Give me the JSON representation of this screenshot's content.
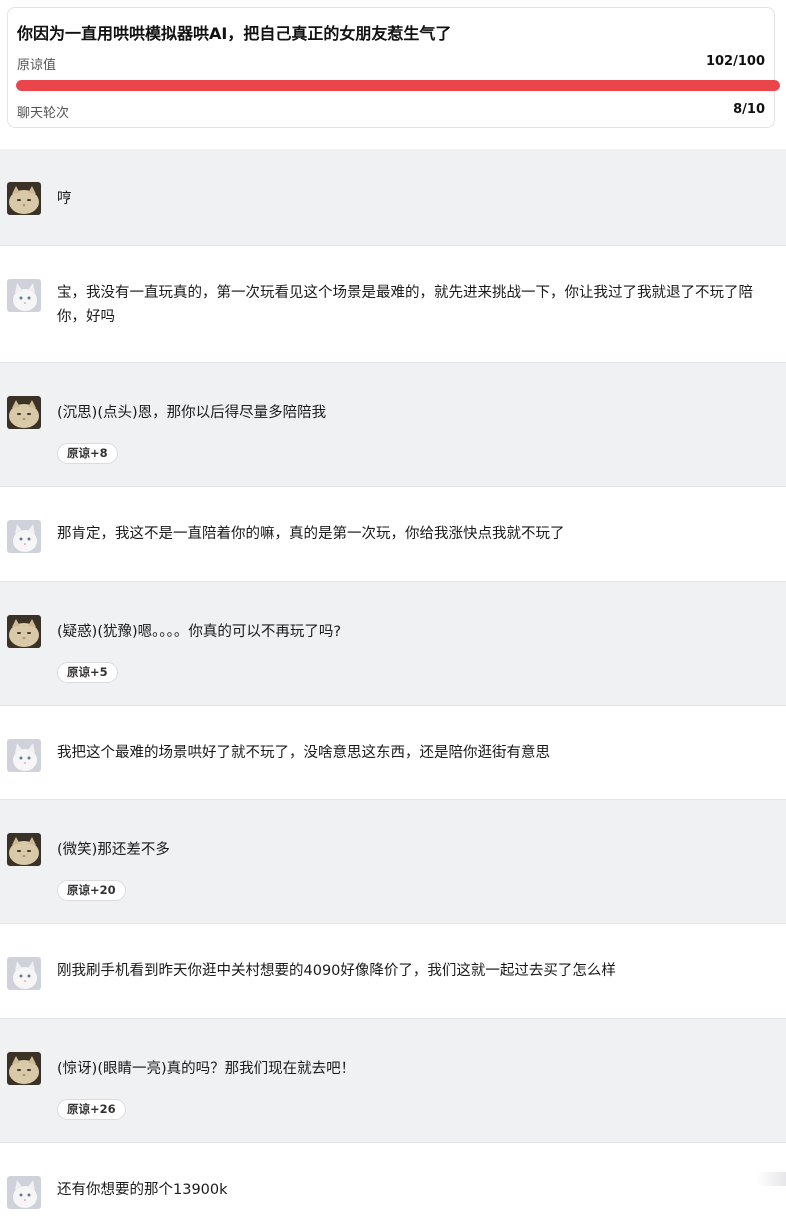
{
  "header": {
    "title": "你因为一直用哄哄模拟器哄AI，把自己真正的女朋友惹生气了",
    "forgiveness_label": "原谅值",
    "forgiveness_value": "102/100",
    "forgiveness_fraction": 1.0,
    "rounds_label": "聊天轮次",
    "rounds_value": "8/10"
  },
  "colors": {
    "progress": "#e9454b",
    "ai_bg": "#f0f1f3",
    "user_bg": "#ffffff"
  },
  "messages": [
    {
      "role": "ai",
      "avatar": "cat-avatar-ai-icon",
      "text": "哼"
    },
    {
      "role": "user",
      "avatar": "cat-avatar-user-icon",
      "text": "宝，我没有一直玩真的，第一次玩看见这个场景是最难的，就先进来挑战一下，你让我过了我就退了不玩了陪你，好吗"
    },
    {
      "role": "ai",
      "avatar": "cat-avatar-ai-icon",
      "text": "(沉思)(点头)恩，那你以后得尽量多陪陪我",
      "badge": "原谅+8"
    },
    {
      "role": "user",
      "avatar": "cat-avatar-user-icon",
      "text": "那肯定，我这不是一直陪着你的嘛，真的是第一次玩，你给我涨快点我就不玩了"
    },
    {
      "role": "ai",
      "avatar": "cat-avatar-ai-icon",
      "text": "(疑惑)(犹豫)嗯。。。。你真的可以不再玩了吗?",
      "badge": "原谅+5"
    },
    {
      "role": "user",
      "avatar": "cat-avatar-user-icon",
      "text": "我把这个最难的场景哄好了就不玩了，没啥意思这东西，还是陪你逛街有意思"
    },
    {
      "role": "ai",
      "avatar": "cat-avatar-ai-icon",
      "text": "(微笑)那还差不多",
      "badge": "原谅+20"
    },
    {
      "role": "user",
      "avatar": "cat-avatar-user-icon",
      "text": "刚我刷手机看到昨天你逛中关村想要的4090好像降价了，我们这就一起过去买了怎么样"
    },
    {
      "role": "ai",
      "avatar": "cat-avatar-ai-icon",
      "text": "(惊讶)(眼睛一亮)真的吗？那我们现在就去吧！",
      "badge": "原谅+26"
    },
    {
      "role": "user",
      "avatar": "cat-avatar-user-icon",
      "text": "还有你想要的那个13900k"
    }
  ]
}
